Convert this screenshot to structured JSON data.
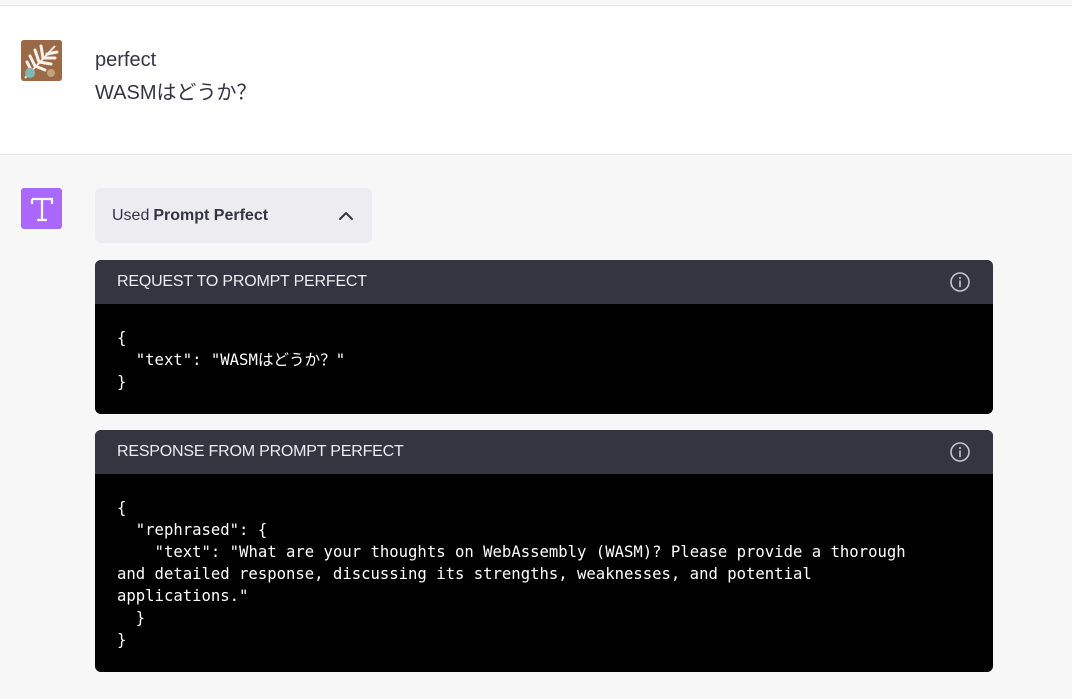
{
  "user_message": {
    "line1": "perfect",
    "line2": "WASMはどうか？"
  },
  "assistant": {
    "avatar_letter": "T",
    "avatar_color": "#ab68ff",
    "plugin_chip": {
      "prefix": "Used",
      "plugin_name": "Prompt Perfect",
      "toggle_icon": "chevron-up-icon"
    },
    "request_panel": {
      "title": "REQUEST TO PROMPT PERFECT",
      "icon": "info-icon",
      "body": "{\n  \"text\": \"WASMはどうか？\"\n}"
    },
    "response_panel": {
      "title": "RESPONSE FROM PROMPT PERFECT",
      "icon": "info-icon",
      "body": "{\n  \"rephrased\": {\n    \"text\": \"What are your thoughts on WebAssembly (WASM)? Please provide a thorough\nand detailed response, discussing its strengths, weaknesses, and potential\napplications.\"\n  }\n}"
    }
  }
}
